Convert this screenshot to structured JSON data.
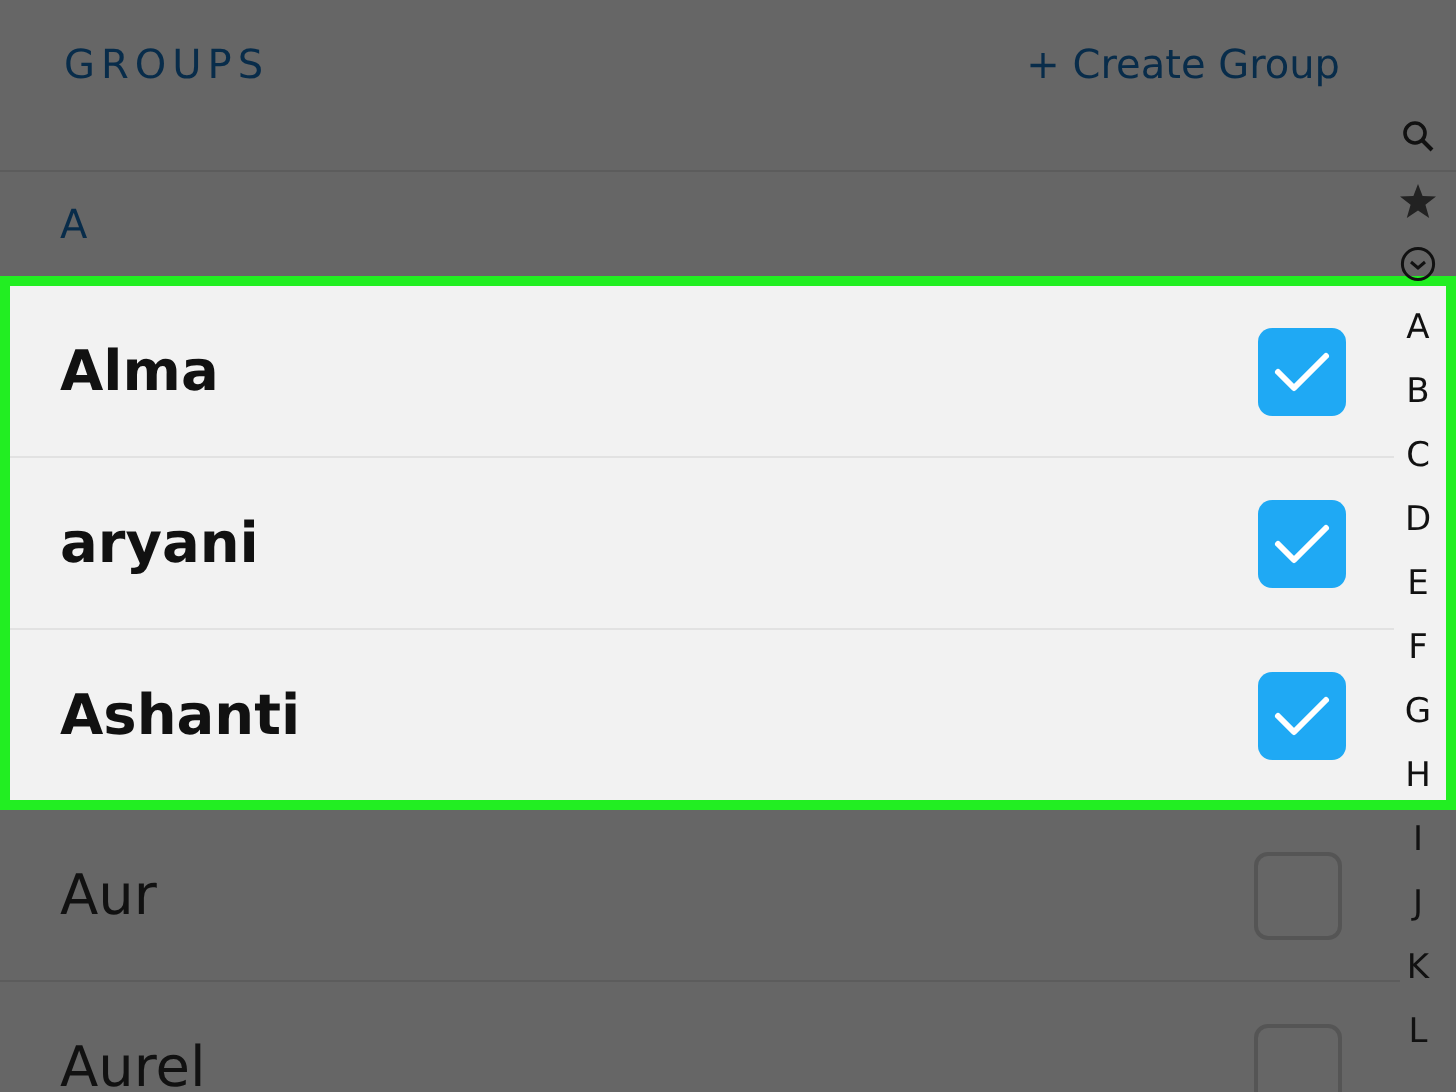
{
  "header": {
    "title": "GROUPS",
    "action": "+ Create Group"
  },
  "section": {
    "letter": "A"
  },
  "contacts": [
    {
      "name": "Alma",
      "checked": true,
      "highlighted": true
    },
    {
      "name": "aryani",
      "checked": true,
      "highlighted": true
    },
    {
      "name": "Ashanti",
      "checked": true,
      "highlighted": true
    },
    {
      "name": "Aur",
      "checked": false,
      "highlighted": false
    },
    {
      "name": "Aurel",
      "checked": false,
      "highlighted": false
    }
  ],
  "index": [
    {
      "kind": "search"
    },
    {
      "kind": "favorites"
    },
    {
      "kind": "recent"
    },
    {
      "kind": "letter",
      "label": "A"
    },
    {
      "kind": "letter",
      "label": "B"
    },
    {
      "kind": "letter",
      "label": "C"
    },
    {
      "kind": "letter",
      "label": "D"
    },
    {
      "kind": "letter",
      "label": "E"
    },
    {
      "kind": "letter",
      "label": "F"
    },
    {
      "kind": "letter",
      "label": "G"
    },
    {
      "kind": "letter",
      "label": "H"
    },
    {
      "kind": "letter",
      "label": "I"
    },
    {
      "kind": "letter",
      "label": "J"
    },
    {
      "kind": "letter",
      "label": "K"
    },
    {
      "kind": "letter",
      "label": "L"
    }
  ]
}
